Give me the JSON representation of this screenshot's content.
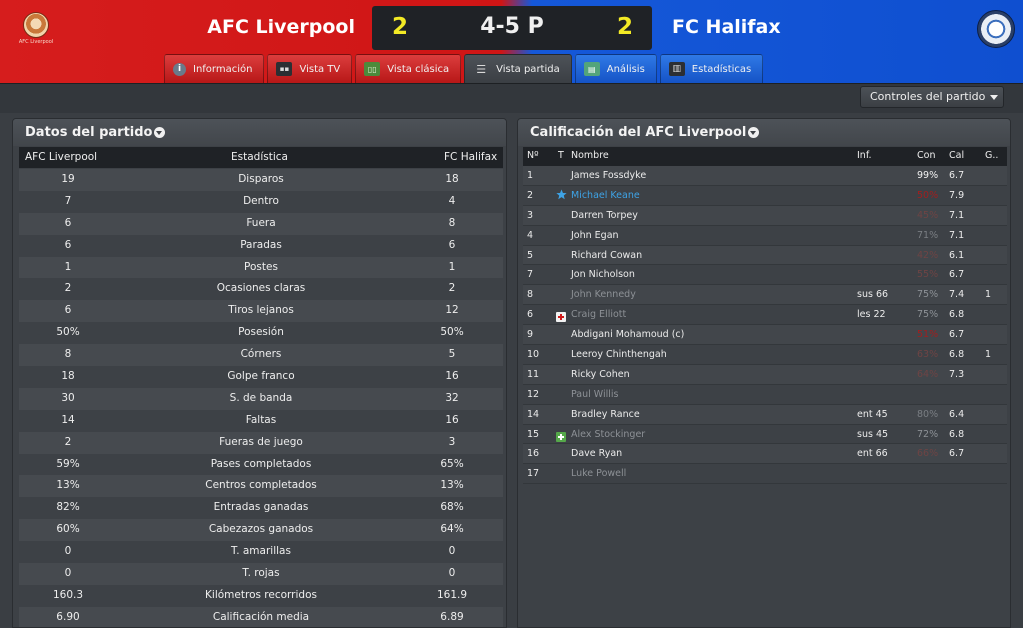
{
  "header": {
    "home_team": "AFC Liverpool",
    "away_team": "FC Halifax",
    "home_score": "2",
    "away_score": "2",
    "result": "4-5 P",
    "home_crest_text": "AFC Liverpool"
  },
  "tabs": [
    {
      "label": "Información",
      "icon": "info-icon"
    },
    {
      "label": "Vista TV",
      "icon": "tv-icon"
    },
    {
      "label": "Vista clásica",
      "icon": "pitch-icon"
    },
    {
      "label": "Vista partida",
      "icon": "match-view-icon"
    },
    {
      "label": "Análisis",
      "icon": "analysis-icon"
    },
    {
      "label": "Estadísticas",
      "icon": "stats-icon"
    }
  ],
  "toolbar": {
    "controls_label": "Controles del partido"
  },
  "stats_panel": {
    "title": "Datos del partido",
    "headers": {
      "home": "AFC Liverpool",
      "stat": "Estadística",
      "away": "FC Halifax"
    },
    "rows": [
      {
        "home": "19",
        "stat": "Disparos",
        "away": "18"
      },
      {
        "home": "7",
        "stat": "Dentro",
        "away": "4"
      },
      {
        "home": "6",
        "stat": "Fuera",
        "away": "8"
      },
      {
        "home": "6",
        "stat": "Paradas",
        "away": "6"
      },
      {
        "home": "1",
        "stat": "Postes",
        "away": "1"
      },
      {
        "home": "2",
        "stat": "Ocasiones claras",
        "away": "2"
      },
      {
        "home": "6",
        "stat": "Tiros lejanos",
        "away": "12"
      },
      {
        "home": "50%",
        "stat": "Posesión",
        "away": "50%"
      },
      {
        "home": "8",
        "stat": "Córners",
        "away": "5"
      },
      {
        "home": "18",
        "stat": "Golpe franco",
        "away": "16"
      },
      {
        "home": "30",
        "stat": "S. de banda",
        "away": "32"
      },
      {
        "home": "14",
        "stat": "Faltas",
        "away": "16"
      },
      {
        "home": "2",
        "stat": "Fueras de juego",
        "away": "3"
      },
      {
        "home": "59%",
        "stat": "Pases completados",
        "away": "65%"
      },
      {
        "home": "13%",
        "stat": "Centros completados",
        "away": "13%"
      },
      {
        "home": "82%",
        "stat": "Entradas ganadas",
        "away": "68%"
      },
      {
        "home": "60%",
        "stat": "Cabezazos ganados",
        "away": "64%"
      },
      {
        "home": "0",
        "stat": "T. amarillas",
        "away": "0"
      },
      {
        "home": "0",
        "stat": "T. rojas",
        "away": "0"
      },
      {
        "home": "160.3",
        "stat": "Kilómetros recorridos",
        "away": "161.9"
      },
      {
        "home": "6.90",
        "stat": "Calificación media",
        "away": "6.89"
      }
    ]
  },
  "ratings_panel": {
    "title": "Calificación del AFC Liverpool",
    "headers": {
      "no": "Nº",
      "t": "T",
      "name": "Nombre",
      "inf": "Inf.",
      "con": "Con",
      "cal": "Cal",
      "g": "G.."
    },
    "rows": [
      {
        "no": "1",
        "badge": "",
        "name": "James Fossdyke",
        "inf": "",
        "con": "99%",
        "con_tone": "white",
        "cal": "6.7",
        "g": "",
        "state": ""
      },
      {
        "no": "2",
        "badge": "star",
        "name": "Michael Keane",
        "inf": "",
        "con": "50%",
        "con_tone": "red",
        "cal": "7.9",
        "g": "",
        "state": "hl"
      },
      {
        "no": "3",
        "badge": "",
        "name": "Darren Torpey",
        "inf": "",
        "con": "45%",
        "con_tone": "faint",
        "cal": "7.1",
        "g": "",
        "state": ""
      },
      {
        "no": "4",
        "badge": "",
        "name": "John Egan",
        "inf": "",
        "con": "71%",
        "con_tone": "grey",
        "cal": "7.1",
        "g": "",
        "state": ""
      },
      {
        "no": "5",
        "badge": "",
        "name": "Richard Cowan",
        "inf": "",
        "con": "42%",
        "con_tone": "faint",
        "cal": "6.1",
        "g": "",
        "state": ""
      },
      {
        "no": "7",
        "badge": "",
        "name": "Jon Nicholson",
        "inf": "",
        "con": "55%",
        "con_tone": "faint",
        "cal": "6.7",
        "g": "",
        "state": ""
      },
      {
        "no": "8",
        "badge": "",
        "name": "John Kennedy",
        "inf": "sus 66",
        "con": "75%",
        "con_tone": "grey",
        "cal": "7.4",
        "g": "1",
        "state": "sub"
      },
      {
        "no": "6",
        "badge": "injury",
        "name": "Craig Elliott",
        "inf": "les 22",
        "con": "75%",
        "con_tone": "grey",
        "cal": "6.8",
        "g": "",
        "state": "sub"
      },
      {
        "no": "9",
        "badge": "",
        "name": "Abdigani Mohamoud (c)",
        "inf": "",
        "con": "51%",
        "con_tone": "red",
        "cal": "6.7",
        "g": "",
        "state": ""
      },
      {
        "no": "10",
        "badge": "",
        "name": "Leeroy Chinthengah",
        "inf": "",
        "con": "63%",
        "con_tone": "faint",
        "cal": "6.8",
        "g": "1",
        "state": ""
      },
      {
        "no": "11",
        "badge": "",
        "name": "Ricky Cohen",
        "inf": "",
        "con": "64%",
        "con_tone": "faint",
        "cal": "7.3",
        "g": "",
        "state": ""
      },
      {
        "no": "12",
        "badge": "",
        "name": "Paul Willis",
        "inf": "",
        "con": "",
        "con_tone": "grey",
        "cal": "",
        "g": "",
        "state": "sub"
      },
      {
        "no": "14",
        "badge": "",
        "name": "Bradley Rance",
        "inf": "ent 45",
        "con": "80%",
        "con_tone": "grey",
        "cal": "6.4",
        "g": "",
        "state": ""
      },
      {
        "no": "15",
        "badge": "subon",
        "name": "Alex Stockinger",
        "inf": "sus 45",
        "con": "72%",
        "con_tone": "grey",
        "cal": "6.8",
        "g": "",
        "state": "sub"
      },
      {
        "no": "16",
        "badge": "",
        "name": "Dave Ryan",
        "inf": "ent 66",
        "con": "66%",
        "con_tone": "faint",
        "cal": "6.7",
        "g": "",
        "state": ""
      },
      {
        "no": "17",
        "badge": "",
        "name": "Luke Powell",
        "inf": "",
        "con": "",
        "con_tone": "grey",
        "cal": "",
        "g": "",
        "state": "sub"
      }
    ]
  },
  "colors": {
    "home_red": "#d61d1d",
    "away_blue": "#1558d9",
    "score_yellow": "#f3ea25",
    "highlight_blue": "#3ea3e6"
  }
}
